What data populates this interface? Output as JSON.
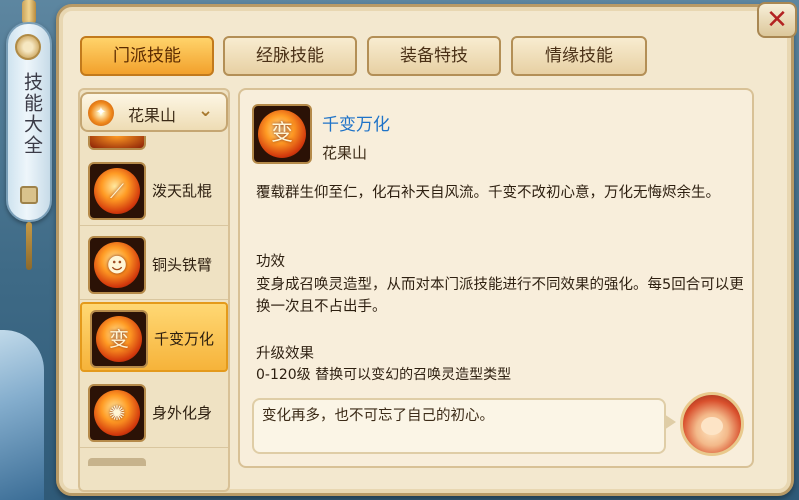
{
  "side_title": "技能大全",
  "close_icon": "close-icon",
  "tabs": [
    {
      "label": "门派技能",
      "active": true
    },
    {
      "label": "经脉技能",
      "active": false
    },
    {
      "label": "装备特技",
      "active": false
    },
    {
      "label": "情缘技能",
      "active": false
    }
  ],
  "sect_selector": {
    "value": "花果山"
  },
  "skills": [
    {
      "name": "泼天乱棍",
      "icon": "staff-flame-icon"
    },
    {
      "name": "铜头铁臂",
      "icon": "iron-monkey-icon"
    },
    {
      "name": "千变万化",
      "icon": "transform-icon",
      "selected": true
    },
    {
      "name": "身外化身",
      "icon": "clone-icon"
    }
  ],
  "detail": {
    "title": "千变万化",
    "sect": "花果山",
    "description": "覆载群生仰至仁，化石补天自风流。千变不改初心意，万化无悔烬余生。",
    "effect_heading": "功效",
    "effect": "变身成召唤灵造型，从而对本门派技能进行不同效果的强化。每5回合可以更换一次且不占出手。",
    "upgrade_heading": "升级效果",
    "upgrade": "0-120级 替换可以变幻的召唤灵造型类型",
    "quote": "变化再多，也不可忘了自己的初心。"
  },
  "colors": {
    "accent_tab": "#f2a12c",
    "title_blue": "#1f73c8",
    "close_red": "#b32222"
  }
}
